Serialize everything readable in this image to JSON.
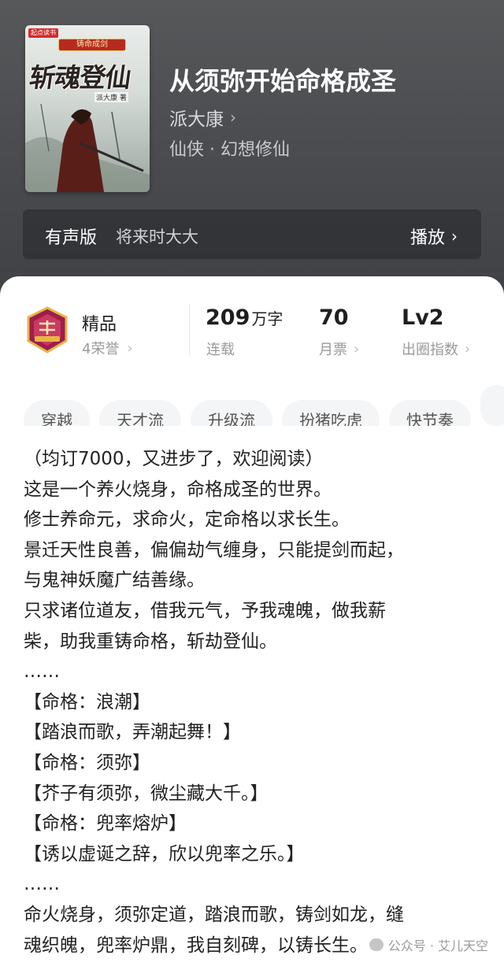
{
  "book": {
    "title": "从须弥开始命格成圣",
    "author": "派大康",
    "genre": "仙侠 · 幻想修仙",
    "cover": {
      "publisher_logo": "起点读书",
      "badge": "铸命成剑",
      "title": "斩魂登仙",
      "author": "派大康 著"
    }
  },
  "audio": {
    "label": "有声版",
    "narrator": "将来时大大",
    "play_label": "播放"
  },
  "stats": {
    "quality": {
      "label": "精品",
      "honors": "4荣誉"
    },
    "words": {
      "number": "209",
      "unit": "万字",
      "status": "连载"
    },
    "monthly_votes": {
      "number": "70",
      "label": "月票"
    },
    "index": {
      "number": "Lv2",
      "label": "出圈指数"
    }
  },
  "tags": [
    "穿越",
    "天才流",
    "升级流",
    "扮猪吃虎",
    "快节奏"
  ],
  "synopsis": [
    "（均订7000，又进步了，欢迎阅读）",
    "这是一个养火烧身，命格成圣的世界。",
    "修士养命元，求命火，定命格以求长生。",
    "景迁天性良善，偏偏劫气缠身，只能提剑而起，",
    "与鬼神妖魔广结善缘。",
    "只求诸位道友，借我元气，予我魂魄，做我薪",
    "柴，助我重铸命格，斩劫登仙。",
    "……",
    "【命格：浪潮】",
    "【踏浪而歌，弄潮起舞！】",
    "【命格：须弥】",
    "【芥子有须弥，微尘藏大千。】",
    "【命格：兜率熔炉】",
    "【诱以虚诞之辞，欣以兜率之乐。】",
    "……",
    "命火烧身，须弥定道，踏浪而歌，铸剑如龙，缝",
    "魂织魄，兜率炉鼎，我自刻碑，以铸长生。"
  ],
  "watermark": "公众号 · 艾儿天空",
  "icons": {
    "chevron": "chevron-right-icon",
    "quality_badge": "premium-badge-icon"
  },
  "colors": {
    "header_bg": "#4b4d50",
    "badge_primary": "#9c1f4a",
    "badge_gold": "#e8b54a"
  }
}
